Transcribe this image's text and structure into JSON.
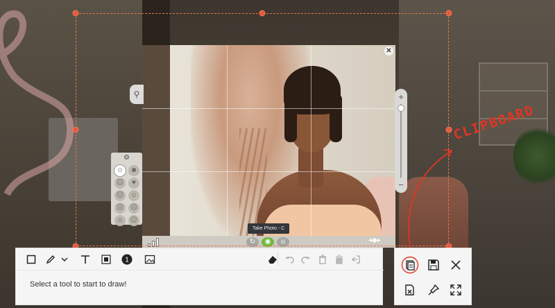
{
  "camera": {
    "tooltip": "Take Photo - C",
    "close_glyph": "✕",
    "zoom_plus": "+",
    "zoom_minus": "−",
    "zoom_level": 0.1
  },
  "emotions": {
    "header_icon": "sliders-icon",
    "items": [
      "happy-icon",
      "playful-icon",
      "sad-icon",
      "flirty-icon",
      "tense-icon",
      "energized-icon",
      "angry-icon",
      "dazed-icon",
      "focused-icon",
      "embarrassed-icon"
    ]
  },
  "annotation": {
    "label": "CLIPBOARD",
    "color": "#e03524"
  },
  "toolbar": {
    "tools": [
      "rectangle-icon",
      "pen-icon",
      "chevron-down-icon",
      "text-icon",
      "blur-icon",
      "step-number-icon",
      "image-icon"
    ],
    "step_number": "1",
    "edit_tools": [
      "eraser-icon",
      "undo-icon",
      "redo-icon",
      "delete-icon",
      "clear-all-icon",
      "exit-icon"
    ],
    "status": "Select a tool to start to draw!"
  },
  "actions": {
    "items": [
      "copy-to-clipboard-icon",
      "save-icon",
      "close-icon",
      "discard-icon",
      "pin-icon",
      "fullscreen-icon"
    ]
  },
  "colors": {
    "selection": "#e8754e",
    "handle": "#e8593a",
    "accent_red": "#e03524"
  }
}
